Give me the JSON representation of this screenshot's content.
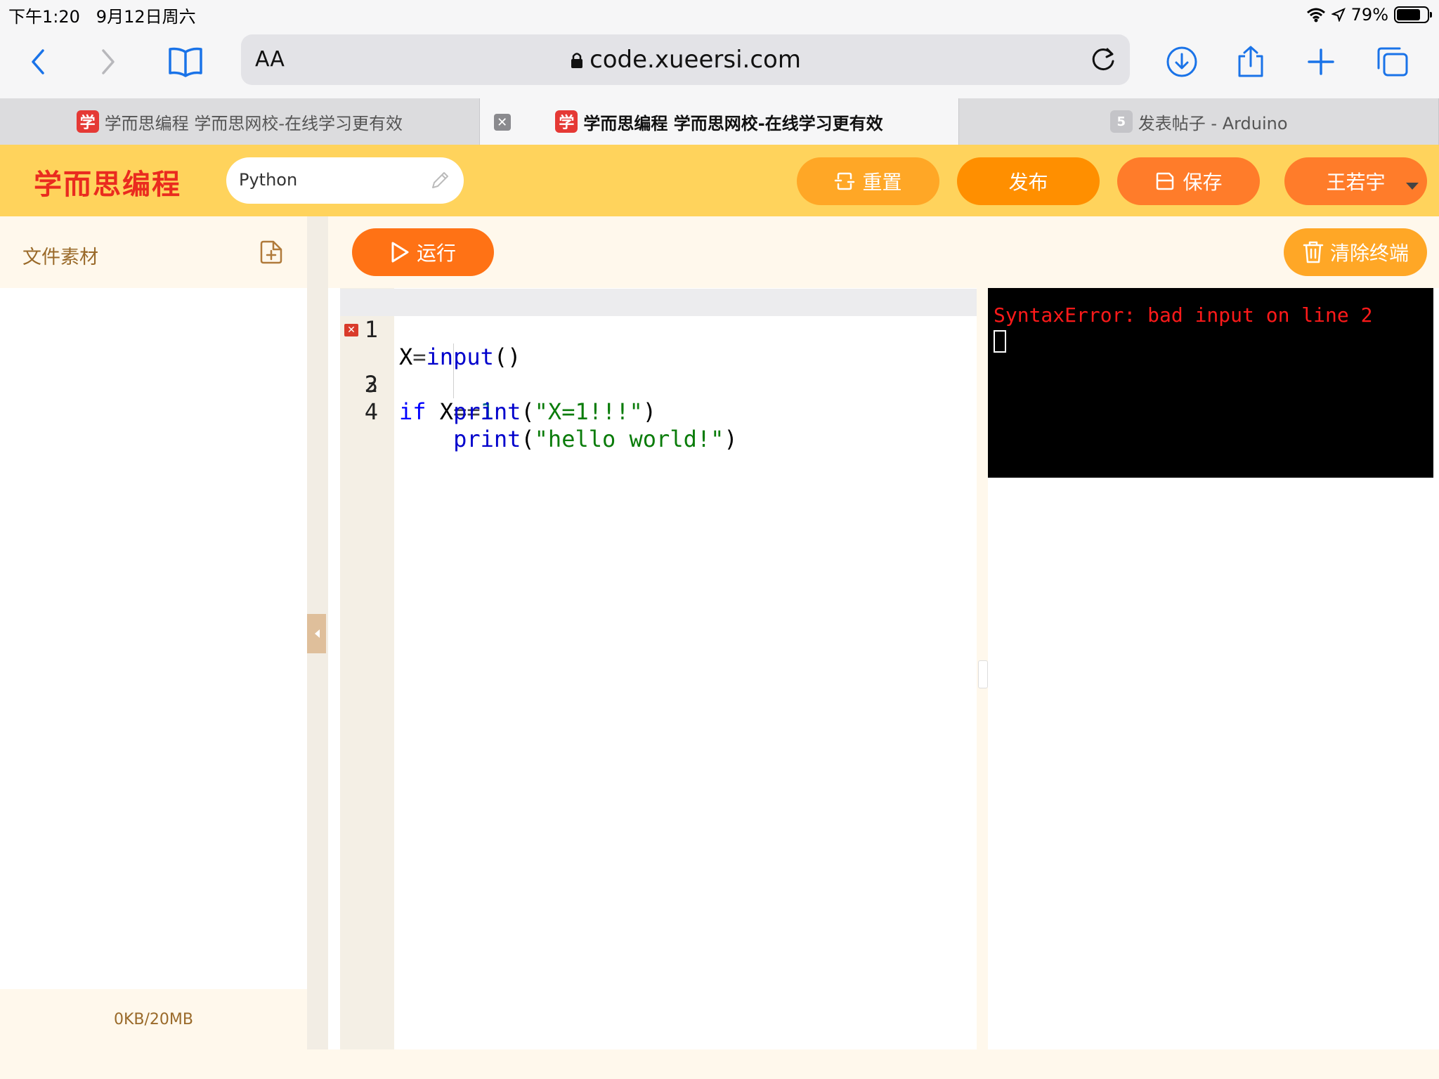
{
  "status": {
    "time": "下午1:20",
    "date": "9月12日周六",
    "battery": "79%",
    "battery_level": 0.79
  },
  "browser": {
    "aa_label": "AA",
    "url": "code.xueersi.com",
    "tabs": [
      {
        "favicon": "学",
        "title": "学而思编程 学而思网校-在线学习更有效"
      },
      {
        "favicon": "学",
        "title": "学而思编程 学而思网校-在线学习更有效"
      },
      {
        "favicon": "5",
        "title": "发表帖子 - Arduino"
      }
    ]
  },
  "app": {
    "logo": "学而思编程",
    "language": "Python",
    "buttons": {
      "reset": "重置",
      "publish": "发布",
      "save": "保存",
      "user": "王若宇",
      "run": "运行",
      "clear": "清除终端"
    },
    "colors": {
      "header": "#ffd35c",
      "run": "#ff7215",
      "logo": "#ea2b1f"
    }
  },
  "sidebar": {
    "title": "文件素材",
    "storage": "0KB/20MB"
  },
  "editor": {
    "line_numbers": [
      "1",
      "2",
      "3",
      "4"
    ],
    "error_line": 2,
    "lines": [
      "X=input()",
      "if X==1",
      "        print(\"X=1!!!\")",
      "        print(\"hello world!\")"
    ]
  },
  "terminal": {
    "output": "SyntaxError: bad input on line 2"
  }
}
